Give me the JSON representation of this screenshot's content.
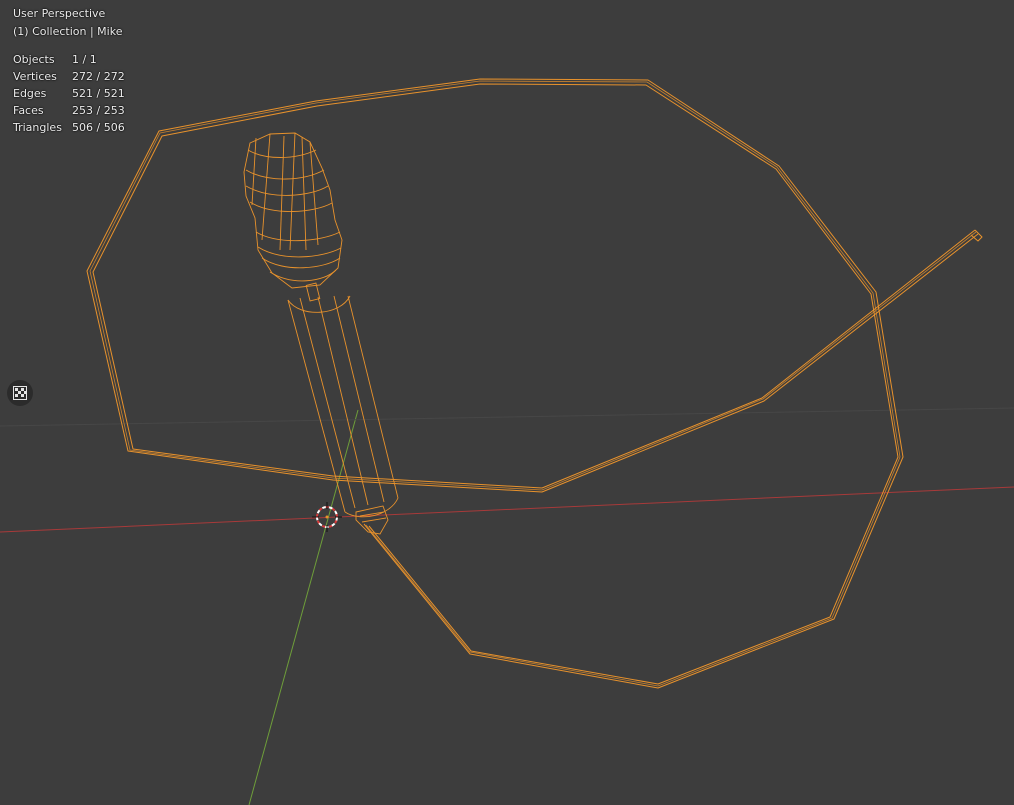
{
  "viewport": {
    "title": "User Perspective",
    "subtitle": "(1) Collection | Mike",
    "background": "#3d3d3d",
    "wire_color": "#e8922c",
    "axis_x_color": "#a83a3a",
    "axis_y_color": "#6e9e3a"
  },
  "stats": [
    {
      "label": "Objects",
      "value": "1 / 1"
    },
    {
      "label": "Vertices",
      "value": "272 / 272"
    },
    {
      "label": "Edges",
      "value": "521 / 521"
    },
    {
      "label": "Faces",
      "value": "253 / 253"
    },
    {
      "label": "Triangles",
      "value": "506 / 506"
    }
  ],
  "gizmos": {
    "toggle_icon": "checker-grid-icon",
    "cursor_icon": "3d-cursor-icon"
  }
}
